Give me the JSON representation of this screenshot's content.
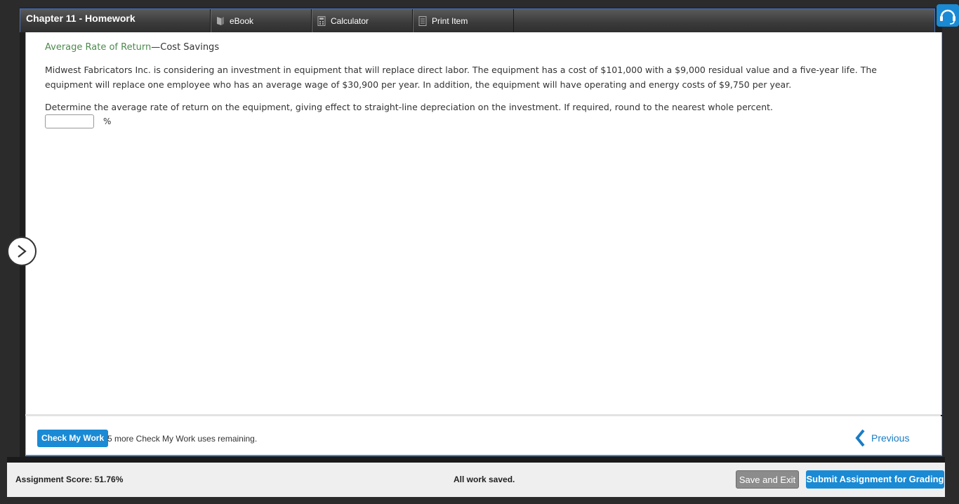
{
  "header": {
    "title": "Chapter 11 - Homework",
    "tabs": [
      {
        "label": "eBook",
        "icon": "book-icon"
      },
      {
        "label": "Calculator",
        "icon": "calculator-icon"
      },
      {
        "label": "Print Item",
        "icon": "print-icon"
      }
    ]
  },
  "question": {
    "title_link": "Average Rate of Return",
    "title_rest": "—Cost Savings",
    "paragraph1": "Midwest Fabricators Inc. is considering an investment in equipment that will replace direct labor. The equipment has a cost of $101,000 with a $9,000 residual value and a five-year life. The equipment will replace one employee who has an average wage of $30,900 per year. In addition, the equipment will have operating and energy costs of $9,750 per year.",
    "paragraph2": "Determine the average rate of return on the equipment, giving effect to straight-line depreciation on the investment. If required, round to the nearest whole percent.",
    "answer_value": "",
    "unit": "%"
  },
  "footer": {
    "check_label": "Check My Work",
    "remaining": "5 more Check My Work uses remaining.",
    "previous_label": "Previous"
  },
  "status": {
    "score": "Assignment Score: 51.76%",
    "saved": "All work saved.",
    "save_exit": "Save and Exit",
    "submit": "Submit Assignment for Grading"
  },
  "colors": {
    "accent": "#1a8ad4",
    "title_green": "#4d8a4d",
    "link_blue": "#1a7cc4"
  }
}
